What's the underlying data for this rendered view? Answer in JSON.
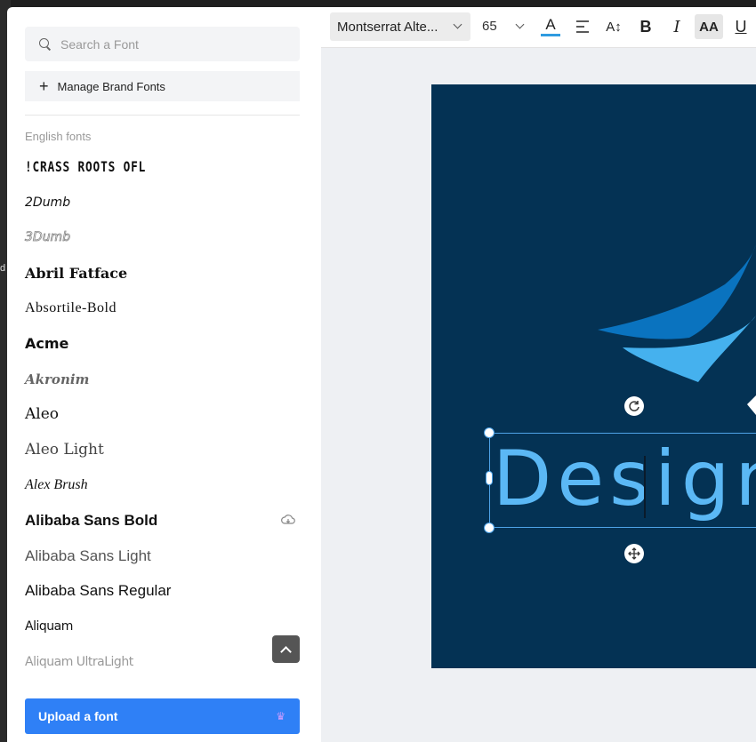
{
  "sidebar": {
    "search_placeholder": "Search a Font",
    "manage_label": "Manage Brand Fonts",
    "section_label": "English fonts",
    "fonts": [
      {
        "name": "!CRASS ROOTS OFL",
        "cloud": false
      },
      {
        "name": "2Dumb",
        "cloud": false
      },
      {
        "name": "3Dumb",
        "cloud": false
      },
      {
        "name": "Abril Fatface",
        "cloud": false
      },
      {
        "name": "Absortile-Bold",
        "cloud": false
      },
      {
        "name": "Acme",
        "cloud": false
      },
      {
        "name": "Akronim",
        "cloud": false
      },
      {
        "name": "Aleo",
        "cloud": false
      },
      {
        "name": "Aleo Light",
        "cloud": false
      },
      {
        "name": "Alex Brush",
        "cloud": false
      },
      {
        "name": "Alibaba Sans Bold",
        "cloud": true
      },
      {
        "name": "Alibaba Sans Light",
        "cloud": false
      },
      {
        "name": "Alibaba Sans Regular",
        "cloud": false
      },
      {
        "name": "Aliquam",
        "cloud": false
      },
      {
        "name": "Aliquam UltraLight",
        "cloud": false
      }
    ],
    "upload_label": "Upload a font"
  },
  "toolbar": {
    "font_name": "Montserrat Alte...",
    "font_size": "65",
    "text_color": "#2f9be0"
  },
  "canvas": {
    "text": "Design",
    "background": "#043254"
  },
  "edge": {
    "text": "d"
  }
}
